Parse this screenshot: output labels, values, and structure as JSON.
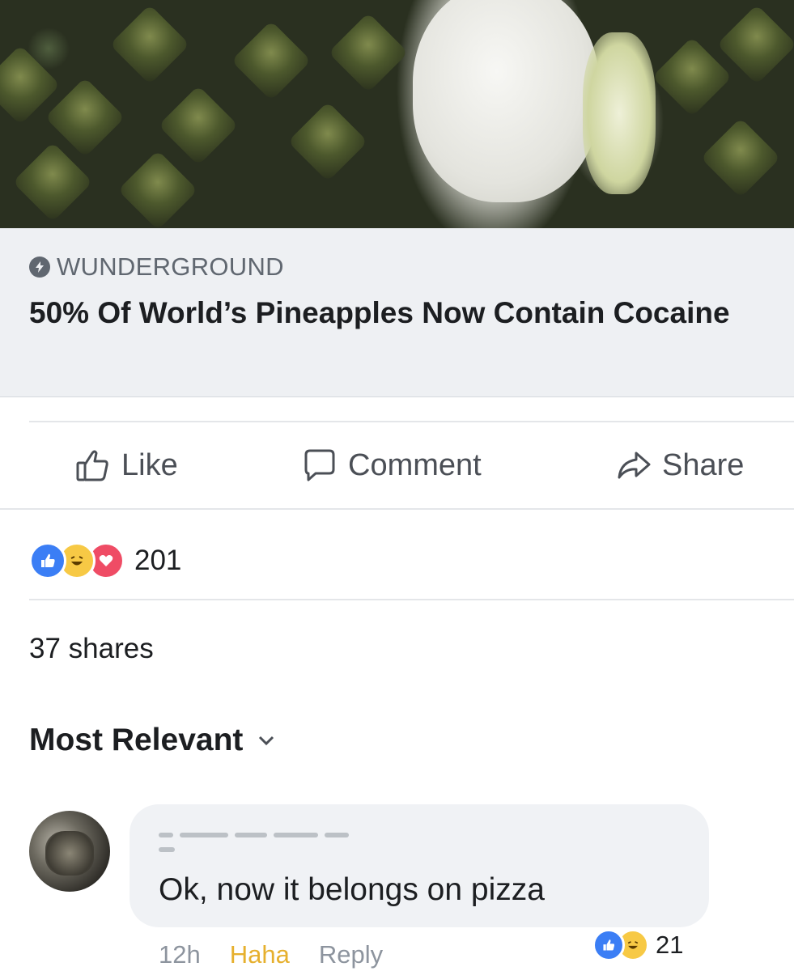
{
  "post": {
    "link": {
      "source": "WUNDERGROUND",
      "headline": "50% Of World’s Pineapples Now Contain Cocaine"
    },
    "actions": {
      "like": "Like",
      "comment": "Comment",
      "share": "Share"
    },
    "reactions": {
      "icons": [
        "like-icon",
        "haha-icon",
        "love-icon"
      ],
      "count": "201"
    },
    "shares": "37 shares"
  },
  "comments": {
    "sort_label": "Most Relevant",
    "items": [
      {
        "text": "Ok, now it belongs on pizza",
        "time": "12h",
        "haha_label": "Haha",
        "reply_label": "Reply",
        "reaction_icons": [
          "like-icon",
          "haha-icon"
        ],
        "reaction_count": "21"
      }
    ]
  },
  "colors": {
    "like_blue": "#3b7ef5",
    "haha_yellow": "#f7c945",
    "love_red": "#ef4c65",
    "link_box_bg": "#eef0f3",
    "comment_bubble_bg": "#f0f2f5"
  }
}
